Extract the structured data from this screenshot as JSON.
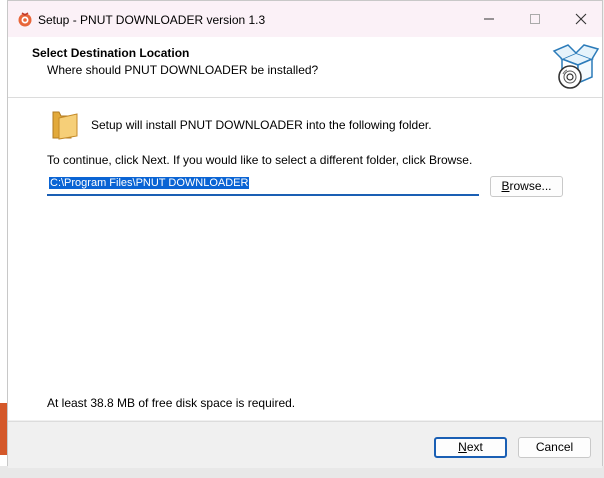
{
  "window": {
    "title": "Setup - PNUT DOWNLOADER version 1.3"
  },
  "header": {
    "title": "Select Destination Location",
    "subtitle": "Where should PNUT DOWNLOADER be installed?"
  },
  "content": {
    "install_text": "Setup will install PNUT DOWNLOADER into the following folder.",
    "continue_text": "To continue, click Next. If you would like to select a different folder, click Browse.",
    "path_value": "C:\\Program Files\\PNUT DOWNLOADER",
    "browse_label_first": "B",
    "browse_label_rest": "rowse...",
    "disk_space_text": "At least 38.8 MB of free disk space is required."
  },
  "footer": {
    "next_label_first": "N",
    "next_label_rest": "ext",
    "cancel_label": "Cancel"
  },
  "colors": {
    "accent": "#1a5fb4",
    "selection": "#0a64d4",
    "titlebar": "#fbf1f7"
  }
}
